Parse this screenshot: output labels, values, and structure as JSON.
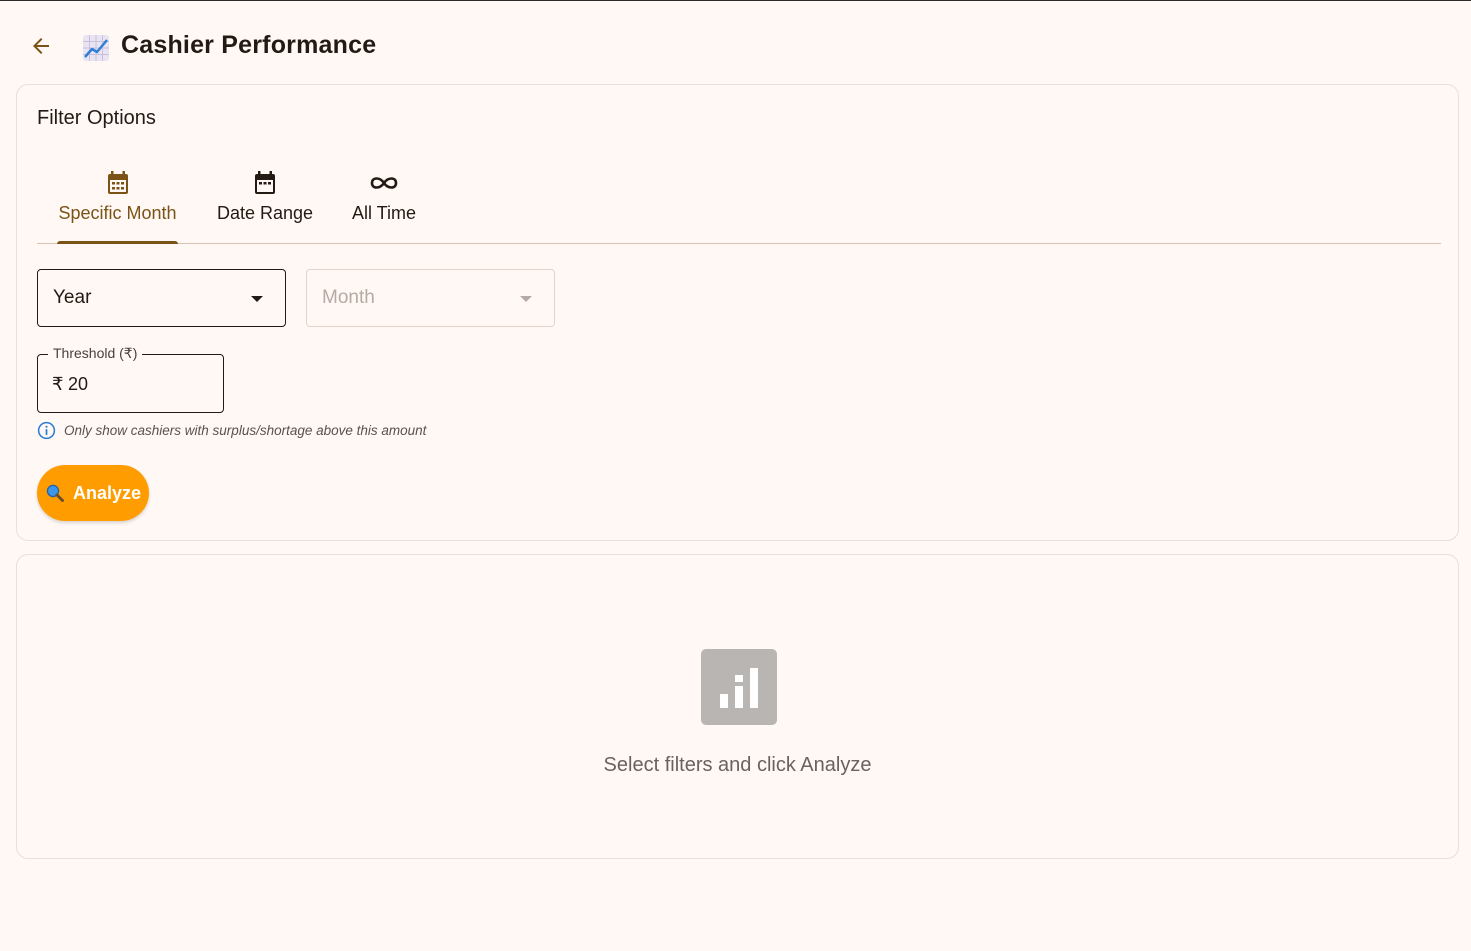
{
  "header": {
    "title": "Cashier Performance",
    "back_icon": "arrow-left-icon",
    "title_icon": "chart-trend-icon"
  },
  "filter": {
    "section_title": "Filter Options",
    "tabs": [
      {
        "label": "Specific Month",
        "icon": "calendar-month-icon",
        "active": true
      },
      {
        "label": "Date Range",
        "icon": "calendar-icon",
        "active": false
      },
      {
        "label": "All Time",
        "icon": "infinity-icon",
        "active": false
      }
    ],
    "year_select": {
      "label": "Year"
    },
    "month_select": {
      "label": "Month",
      "disabled": true
    },
    "threshold": {
      "label": "Threshold (₹)",
      "prefix": "₹",
      "value": "20"
    },
    "hint": "Only show cashiers with surplus/shortage above this amount",
    "analyze_label": "Analyze"
  },
  "results": {
    "empty_message": "Select filters and click Analyze",
    "empty_icon": "bar-chart-icon"
  },
  "colors": {
    "accent": "#7b5317",
    "button": "#ff9d00",
    "background": "#fff8f5"
  }
}
